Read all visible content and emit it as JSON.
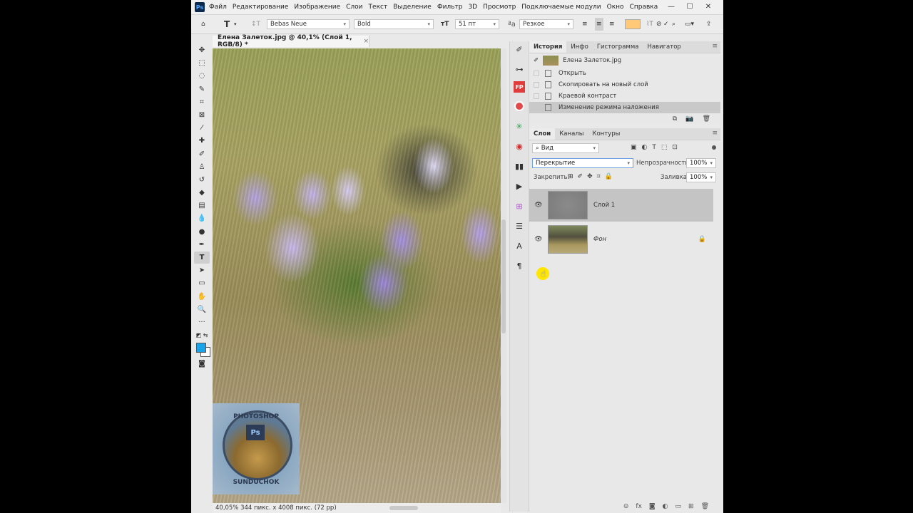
{
  "menubar": {
    "logo": "Ps",
    "items": [
      "Файл",
      "Редактирование",
      "Изображение",
      "Слои",
      "Текст",
      "Выделение",
      "Фильтр",
      "3D",
      "Просмотр",
      "Подключаемые модули",
      "Окно",
      "Справка"
    ],
    "window_controls": [
      "—",
      "☐",
      "✕"
    ]
  },
  "options": {
    "font_family": "Bebas Neue",
    "font_style": "Bold",
    "font_size": "51 пт",
    "antialias": "Резкое",
    "text_color": "#ffc977"
  },
  "document": {
    "tab_title": "Елена Залеток.jpg @ 40,1% (Слой 1, RGB/8) *",
    "tab_close": "×",
    "status": "40,05%  344 пикс. x 4008 пикс. (72 pp)"
  },
  "watermark": {
    "top_text": "PHOTOSHOP",
    "logo_text": "Ps",
    "bottom_text": "SUNDUCHOK"
  },
  "history": {
    "tabs": [
      "История",
      "Инфо",
      "Гистограмма",
      "Навигатор"
    ],
    "snapshot": "Елена Залеток.jpg",
    "items": [
      "Открыть",
      "Скопировать на новый слой",
      "Краевой контраст",
      "Изменение режима наложения"
    ],
    "selected_index": 3
  },
  "layers": {
    "tabs": [
      "Слои",
      "Каналы",
      "Контуры"
    ],
    "filter_label": "Вид",
    "blend_mode": "Перекрытие",
    "opacity_label": "Непрозрачность:",
    "opacity_value": "100%",
    "lock_label": "Закрепить:",
    "fill_label": "Заливка:",
    "fill_value": "100%",
    "items": [
      {
        "name": "Слой 1",
        "visible": true,
        "selected": true,
        "locked": false
      },
      {
        "name": "Фон",
        "visible": true,
        "selected": false,
        "locked": true
      }
    ]
  },
  "colors": {
    "foreground": "#1aa3e8",
    "background": "#ffffff",
    "cursor_highlight": "#ffe600"
  }
}
